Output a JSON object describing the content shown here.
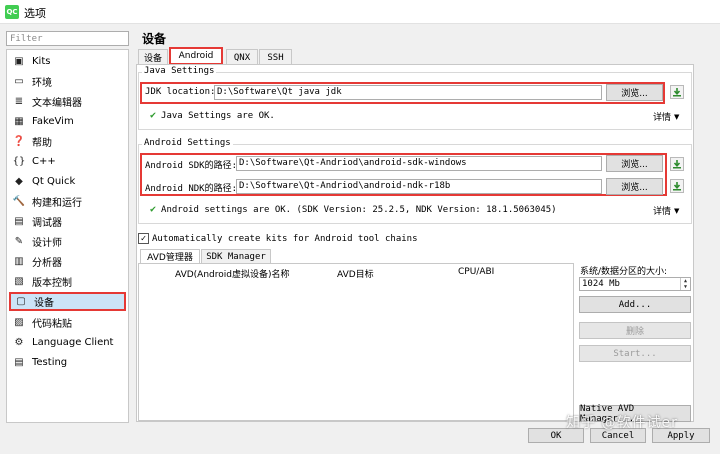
{
  "window": {
    "title": "选项",
    "icon": "qt-logo-icon",
    "icon_text": "QC"
  },
  "sidebar": {
    "filter_placeholder": "Filter",
    "items": [
      {
        "label": "Kits",
        "icon": "kits-icon",
        "glyph": "▣"
      },
      {
        "label": "环境",
        "icon": "environment-icon",
        "glyph": "▭"
      },
      {
        "label": "文本编辑器",
        "icon": "text-editor-icon",
        "glyph": "≣"
      },
      {
        "label": "FakeVim",
        "icon": "fakevim-icon",
        "glyph": "▦"
      },
      {
        "label": "帮助",
        "icon": "help-icon",
        "glyph": "❓"
      },
      {
        "label": "C++",
        "icon": "cpp-icon",
        "glyph": "{}"
      },
      {
        "label": "Qt Quick",
        "icon": "qt-quick-icon",
        "glyph": "◆"
      },
      {
        "label": "构建和运行",
        "icon": "build-run-icon",
        "glyph": "🔨"
      },
      {
        "label": "调试器",
        "icon": "debugger-icon",
        "glyph": "▤"
      },
      {
        "label": "设计师",
        "icon": "designer-icon",
        "glyph": "✎"
      },
      {
        "label": "分析器",
        "icon": "analyzer-icon",
        "glyph": "▥"
      },
      {
        "label": "版本控制",
        "icon": "version-control-icon",
        "glyph": "▧"
      },
      {
        "label": "设备",
        "icon": "devices-icon",
        "glyph": "▢"
      },
      {
        "label": "代码粘贴",
        "icon": "code-paste-icon",
        "glyph": "▨"
      },
      {
        "label": "Language Client",
        "icon": "language-client-icon",
        "glyph": "⚙"
      },
      {
        "label": "Testing",
        "icon": "testing-icon",
        "glyph": "▤"
      }
    ],
    "selected_index": 12
  },
  "main": {
    "title": "设备",
    "tabs": [
      "设备",
      "Android",
      "QNX",
      "SSH"
    ],
    "active_tab": 1,
    "java": {
      "group_title": "Java Settings",
      "jdk_label": "JDK location:",
      "jdk_value": "D:\\Software\\Qt java jdk",
      "browse_label": "浏览...",
      "status": "Java Settings are OK.",
      "details_label": "详情"
    },
    "android": {
      "group_title": "Android Settings",
      "sdk_label": "Android SDK的路径:",
      "sdk_value": "D:\\Software\\Qt-Andriod\\android-sdk-windows",
      "ndk_label": "Android NDK的路径:",
      "ndk_value": "D:\\Software\\Qt-Andriod\\android-ndk-r18b",
      "browse_label": "浏览...",
      "status": "Android settings are OK.  (SDK Version: 25.2.5, NDK Version: 18.1.5063045)",
      "details_label": "详情"
    },
    "auto_kits": {
      "label": "Automatically create kits for Android tool chains",
      "checked": true
    },
    "subtabs": [
      "AVD管理器",
      "SDK Manager"
    ],
    "avd_columns": [
      "AVD(Android虚拟设备)名称",
      "AVD目标",
      "CPU/ABI"
    ],
    "sdcard_label": "系统/数据分区的大小:",
    "sdcard_value": "1024 Mb",
    "add_label": "Add...",
    "remove_label": "删除",
    "start_label": "Start...",
    "native_avd_label": "Native AVD Manager..."
  },
  "footer": {
    "ok_label": "OK",
    "cancel_label": "Cancel",
    "apply_label": "Apply"
  },
  "watermark": "知乎 @软件试er",
  "colors": {
    "highlight": "#e53935",
    "selection": "#cce4f7",
    "ok_check": "#2e9b2e",
    "download_arrow": "#2e8b2e"
  }
}
